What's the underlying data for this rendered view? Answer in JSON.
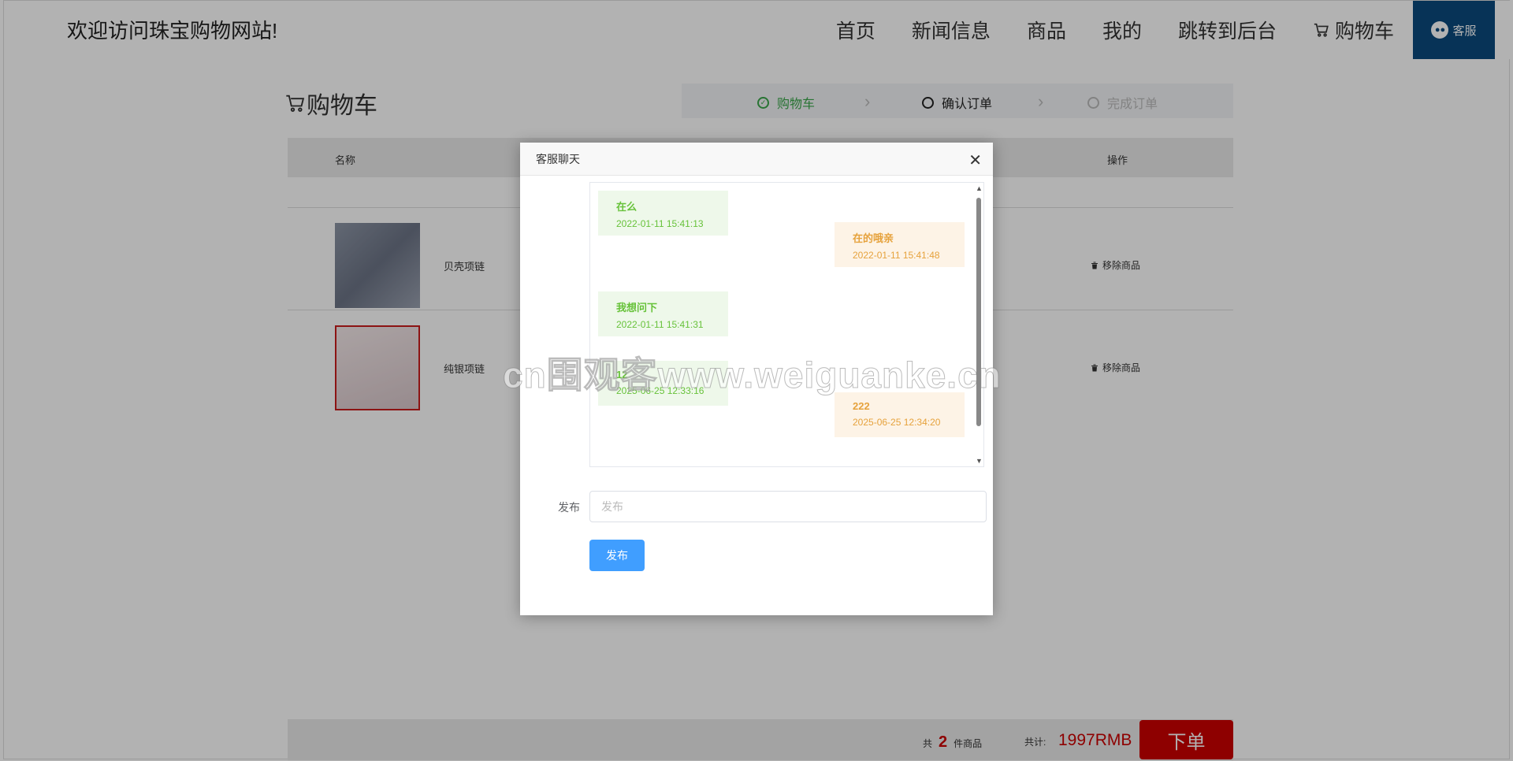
{
  "header": {
    "site_title": "欢迎访问珠宝购物网站!",
    "nav": [
      "首页",
      "新闻信息",
      "商品",
      "我的",
      "跳转到后台"
    ],
    "cart_label": "购物车",
    "kefu_label": "客服"
  },
  "cart": {
    "title": "购物车",
    "steps": [
      "购物车",
      "确认订单",
      "完成订单"
    ],
    "columns": {
      "name": "名称",
      "action": "操作"
    },
    "items": [
      {
        "name": "贝壳项链",
        "remove_label": "移除商品"
      },
      {
        "name": "纯银项链",
        "remove_label": "移除商品"
      }
    ],
    "footer": {
      "count_prefix": "共",
      "count": "2",
      "count_suffix": "件商品",
      "total_label": "共计:",
      "total_amount": "1997RMB",
      "order_button": "下单"
    }
  },
  "dialog": {
    "title": "客服聊天",
    "messages": [
      {
        "side": "left",
        "text": "在么",
        "time": "2022-01-11 15:41:13"
      },
      {
        "side": "right",
        "text": "在的哦亲",
        "time": "2022-01-11 15:41:48"
      },
      {
        "side": "left",
        "text": "我想问下",
        "time": "2022-01-11 15:41:31"
      },
      {
        "side": "left",
        "text": "12",
        "time": "2025-06-25 12:33:16"
      },
      {
        "side": "right",
        "text": "222",
        "time": "2025-06-25 12:34:20"
      }
    ],
    "publish_label": "发布",
    "publish_placeholder": "发布",
    "publish_button": "发布"
  },
  "watermark": "cn围观客www.weiguanke.cn",
  "colors": {
    "brand_blue": "#0b4a7d",
    "price_red": "#cc0000",
    "step_green": "#3aa64a",
    "primary_button": "#409eff",
    "msg_left_text": "#67c23a",
    "msg_right_text": "#e6a23c"
  }
}
